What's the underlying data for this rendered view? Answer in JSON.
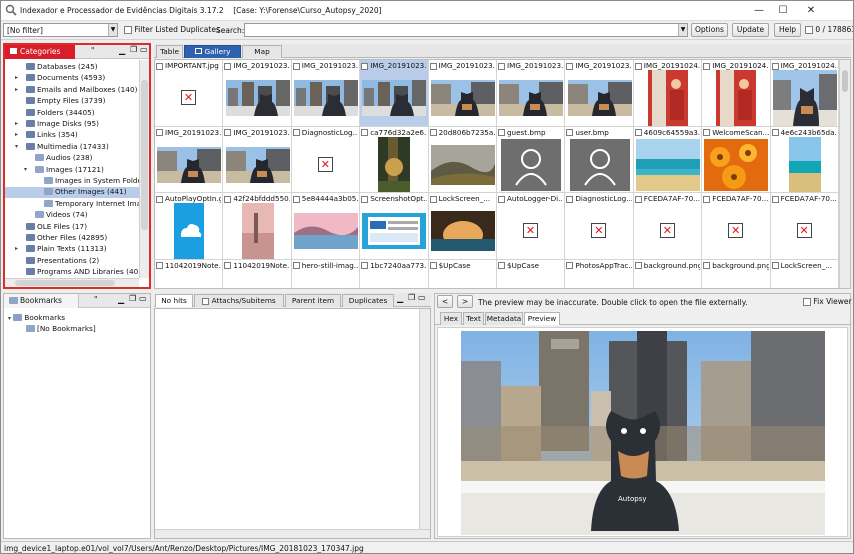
{
  "window": {
    "title": "Indexador e Processador de Evidências Digitais 3.17.2",
    "case": "[Case: Y:\\Forense\\Curso_Autopsy_2020]",
    "minimize": "—",
    "maximize": "☐",
    "close": "✕"
  },
  "toolbar": {
    "filter_value": "[No filter]",
    "filter_duplicates_label": "Filter Listed Duplicates",
    "search_label": "Search:",
    "search_value": "",
    "options": "Options",
    "update": "Update",
    "help": "Help",
    "count": "0 / 178863"
  },
  "categories": {
    "tab": "Categories",
    "tab2": "\"",
    "items": [
      {
        "label": "Databases (245)",
        "indent": 1,
        "exp": ""
      },
      {
        "label": "Documents (4593)",
        "indent": 1,
        "exp": "▸"
      },
      {
        "label": "Emails and Mailboxes (140)",
        "indent": 1,
        "exp": "▸"
      },
      {
        "label": "Empty Files (3739)",
        "indent": 1,
        "exp": ""
      },
      {
        "label": "Folders (34405)",
        "indent": 1,
        "exp": ""
      },
      {
        "label": "Image Disks (95)",
        "indent": 1,
        "exp": "▸"
      },
      {
        "label": "Links (354)",
        "indent": 1,
        "exp": "▸"
      },
      {
        "label": "Multimedia (17433)",
        "indent": 1,
        "exp": "▾"
      },
      {
        "label": "Audios (238)",
        "indent": 2,
        "exp": ""
      },
      {
        "label": "Images (17121)",
        "indent": 2,
        "exp": "▾"
      },
      {
        "label": "Images in System Folders",
        "indent": 3,
        "exp": ""
      },
      {
        "label": "Other Images (441)",
        "indent": 3,
        "exp": "",
        "selected": true
      },
      {
        "label": "Temporary Internet Image",
        "indent": 3,
        "exp": ""
      },
      {
        "label": "Videos (74)",
        "indent": 2,
        "exp": ""
      },
      {
        "label": "OLE Files (17)",
        "indent": 1,
        "exp": ""
      },
      {
        "label": "Other Files (42895)",
        "indent": 1,
        "exp": ""
      },
      {
        "label": "Plain Texts (11313)",
        "indent": 1,
        "exp": "▸"
      },
      {
        "label": "Presentations (2)",
        "indent": 1,
        "exp": ""
      },
      {
        "label": "Programs AND Libraries (4055",
        "indent": 1,
        "exp": ""
      }
    ]
  },
  "bookmarks": {
    "tab": "Bookmarks",
    "tab2": "\"",
    "root": "Bookmarks",
    "child": "[No Bookmarks]"
  },
  "view_tabs": [
    "Table",
    "Gallery",
    "Map"
  ],
  "gallery": {
    "cells": [
      {
        "label": "IMPORTANT.jpg",
        "thumb": "x"
      },
      {
        "label": "IMG_20191023...",
        "thumb": "city"
      },
      {
        "label": "IMG_20191023...",
        "thumb": "city"
      },
      {
        "label": "IMG_20191023...",
        "thumb": "city",
        "selected": true
      },
      {
        "label": "IMG_20191023...",
        "thumb": "dogwide"
      },
      {
        "label": "IMG_20191023...",
        "thumb": "dogwide"
      },
      {
        "label": "IMG_20191023...",
        "thumb": "dogwide"
      },
      {
        "label": "IMG_20191024...",
        "thumb": "redroom"
      },
      {
        "label": "IMG_20191024...",
        "thumb": "redroom"
      },
      {
        "label": "IMG_20191024...",
        "thumb": "dogcity"
      },
      {
        "label": "IMG_20191023...",
        "thumb": "dogwide"
      },
      {
        "label": "IMG_20191023...",
        "thumb": "dogwide"
      },
      {
        "label": "DiagnosticLog...",
        "thumb": "x"
      },
      {
        "label": "ca776d32a2e6...",
        "thumb": "forest"
      },
      {
        "label": "20d806b7235a...",
        "thumb": "hills"
      },
      {
        "label": "guest.bmp",
        "thumb": "user"
      },
      {
        "label": "user.bmp",
        "thumb": "user"
      },
      {
        "label": "4609c64559a3...",
        "thumb": "beach"
      },
      {
        "label": "WelcomeScan...",
        "thumb": "flowers"
      },
      {
        "label": "4e6c243b65da...",
        "thumb": "beach2"
      },
      {
        "label": "AutoPlayOptIn.gif",
        "thumb": "cloud"
      },
      {
        "label": "42f24bfddd550...",
        "thumb": "sunset"
      },
      {
        "label": "5e84444a3b05...",
        "thumb": "lake"
      },
      {
        "label": "ScreenshotOpt...",
        "thumb": "screen"
      },
      {
        "label": "LockScreen_...",
        "thumb": "cave"
      },
      {
        "label": "AutoLogger-Di...",
        "thumb": "x"
      },
      {
        "label": "DiagnosticLog...",
        "thumb": "x"
      },
      {
        "label": "FCEDA7AF-70...",
        "thumb": "x"
      },
      {
        "label": "FCEDA7AF-70...",
        "thumb": "x"
      },
      {
        "label": "FCEDA7AF-70...",
        "thumb": "x"
      },
      {
        "label": "11042019Note...",
        "thumb": "none"
      },
      {
        "label": "11042019Note...",
        "thumb": "none"
      },
      {
        "label": "hero-still-imag...",
        "thumb": "none"
      },
      {
        "label": "1bc7240aa773...",
        "thumb": "none"
      },
      {
        "label": "$UpCase",
        "thumb": "none"
      },
      {
        "label": "$UpCase",
        "thumb": "none"
      },
      {
        "label": "PhotosAppTrac...",
        "thumb": "none"
      },
      {
        "label": "background.png",
        "thumb": "none"
      },
      {
        "label": "background.png",
        "thumb": "none"
      },
      {
        "label": "LockScreen_...",
        "thumb": "none"
      }
    ]
  },
  "lower_tabs": [
    "No hits",
    "Attachs/Subitems",
    "Parent item",
    "Duplicates"
  ],
  "preview": {
    "prev": "<",
    "next": ">",
    "notice": "The preview may be inaccurate. Double click to open the file externally.",
    "fix_viewer": "Fix Viewer",
    "tabs": [
      "Hex",
      "Text",
      "Metadata",
      "Preview"
    ],
    "active_tab": "Preview",
    "figure_text": "Autopsy"
  },
  "status": {
    "path": "img_device1_laptop.e01/vol_vol7/Users/Ant/Renzo/Desktop/Pictures/IMG_20181023_170347.jpg"
  },
  "colors": {
    "categories_tab": "#d81e2b",
    "selection": "#b9cdea",
    "accent_border": "#e02b2b"
  }
}
